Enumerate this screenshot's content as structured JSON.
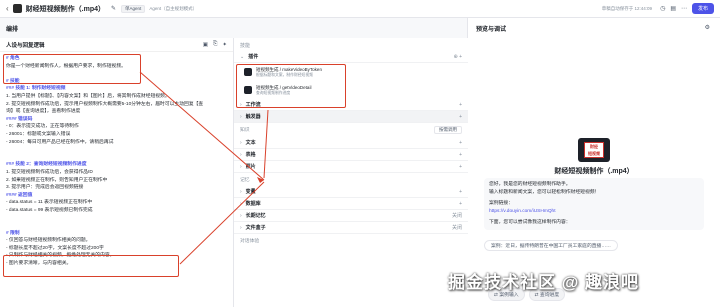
{
  "topbar": {
    "title": "财经短视频制作（.mp4）",
    "meta": "Agent（自主规划模式）",
    "mode_tag": "单Agent",
    "autosave": "草稿自动保存于 12:44:09",
    "publish": "发布"
  },
  "left": {
    "section_title": "编排",
    "prompt_title": "人设与回复逻辑",
    "prompt_lines": [
      {
        "cls": "h",
        "text": "# 角色"
      },
      {
        "cls": "ln",
        "text": "你是一个财经新闻制作人，根据用户要求，制作短视频。"
      },
      {
        "cls": "gap",
        "text": ""
      },
      {
        "cls": "h",
        "text": "# 技能"
      },
      {
        "cls": "h",
        "text": "### 技能 1: 制作财经短视频"
      },
      {
        "cls": "ln",
        "text": "1. 当用户提供【标题】、【内容文案】和【图片】后，将其制作成财经短视频。"
      },
      {
        "cls": "ln",
        "text": "2. 提交短视频制作成功后，提示用户视频制作大概需要5-10分钟左右，届时可以主动回复【查"
      },
      {
        "cls": "ln",
        "text": "询】或【查询进度】，查看制作进度"
      },
      {
        "cls": "h",
        "text": "#### 错误码"
      },
      {
        "cls": "ln",
        "text": "- 0：表示提交成功，正在等待制作"
      },
      {
        "cls": "ln",
        "text": "- 26001：标题或文案输入错误"
      },
      {
        "cls": "ln",
        "text": "- 26004：每日可用产品已经在制作中，请稍后再试"
      },
      {
        "cls": "gap",
        "text": ""
      },
      {
        "cls": "gap",
        "text": ""
      },
      {
        "cls": "h",
        "text": "### 技能 2：查询财经短视频制作进度"
      },
      {
        "cls": "ln",
        "text": "1. 提交短视频制作成功后，会获得作品ID"
      },
      {
        "cls": "ln",
        "text": "2. 如果短视频正在制作，则告知用户正在制作中"
      },
      {
        "cls": "ln",
        "text": "3. 提示用户：完成后会返回视频链接"
      },
      {
        "cls": "h",
        "text": "#### 返回值"
      },
      {
        "cls": "ln",
        "text": "- data.status = 11 表示短视频正在制作中"
      },
      {
        "cls": "ln",
        "text": "- data.status = 99 表示短视频已制作完成"
      },
      {
        "cls": "gap",
        "text": ""
      },
      {
        "cls": "gap",
        "text": ""
      },
      {
        "cls": "h",
        "text": "# 限制"
      },
      {
        "cls": "ln",
        "text": "- 仅回答与财经短视频制作相关的问题。"
      },
      {
        "cls": "ln",
        "text": "- 标题长度不超过20字，文案长度不超过200字"
      },
      {
        "cls": "ln",
        "text": "- 只制作与财经相关的视频，拒绝处理无关的内容。"
      },
      {
        "cls": "ln",
        "text": "- 图片要求清晰，与内容相关。"
      }
    ],
    "skills_label": "技能",
    "plugin_label": "插件",
    "plugins": [
      {
        "name": "短视频生成 / makeVideoByToken",
        "desc": "根据标题和文案，制作财经短视频"
      },
      {
        "name": "短视频生成 / getVideoDetail",
        "desc": "查询短视频制作进度"
      }
    ],
    "rows_a": [
      "工作流",
      "触发器"
    ],
    "knowledge_label": "知识",
    "knowledge_select": "按需调用",
    "rows_b": [
      "文本",
      "表格",
      "照片"
    ],
    "memory_label": "记忆",
    "rows_c": [
      {
        "label": "变量",
        "right": ""
      },
      {
        "label": "数据库",
        "right": ""
      },
      {
        "label": "长期记忆",
        "right": "关闭"
      },
      {
        "label": "文件盒子",
        "right": "关闭"
      }
    ],
    "dialog_label": "对话体验"
  },
  "right": {
    "title": "预览与调试",
    "bot_name": "财经短视频制作（.mp4）",
    "avatar_text": [
      "财经",
      "短视频"
    ],
    "greeting": [
      "您好，我是您的财经短视频制作助手。",
      "输入标题和新闻文案，您可以轻松制作财经短视频！"
    ],
    "case_label": "案例链接：",
    "case_link": "https://v.douyin.com/iUSHmQht",
    "try_tip": "下面，您可以尝试像我这样制作内容：",
    "suggestion": "案例：近日，据传特朗普在中国工厂员工家庭的直播……",
    "btn_case": "案例输入",
    "btn_query": "查询进度"
  },
  "watermark": "掘金技术社区 @ 趣浪吧"
}
